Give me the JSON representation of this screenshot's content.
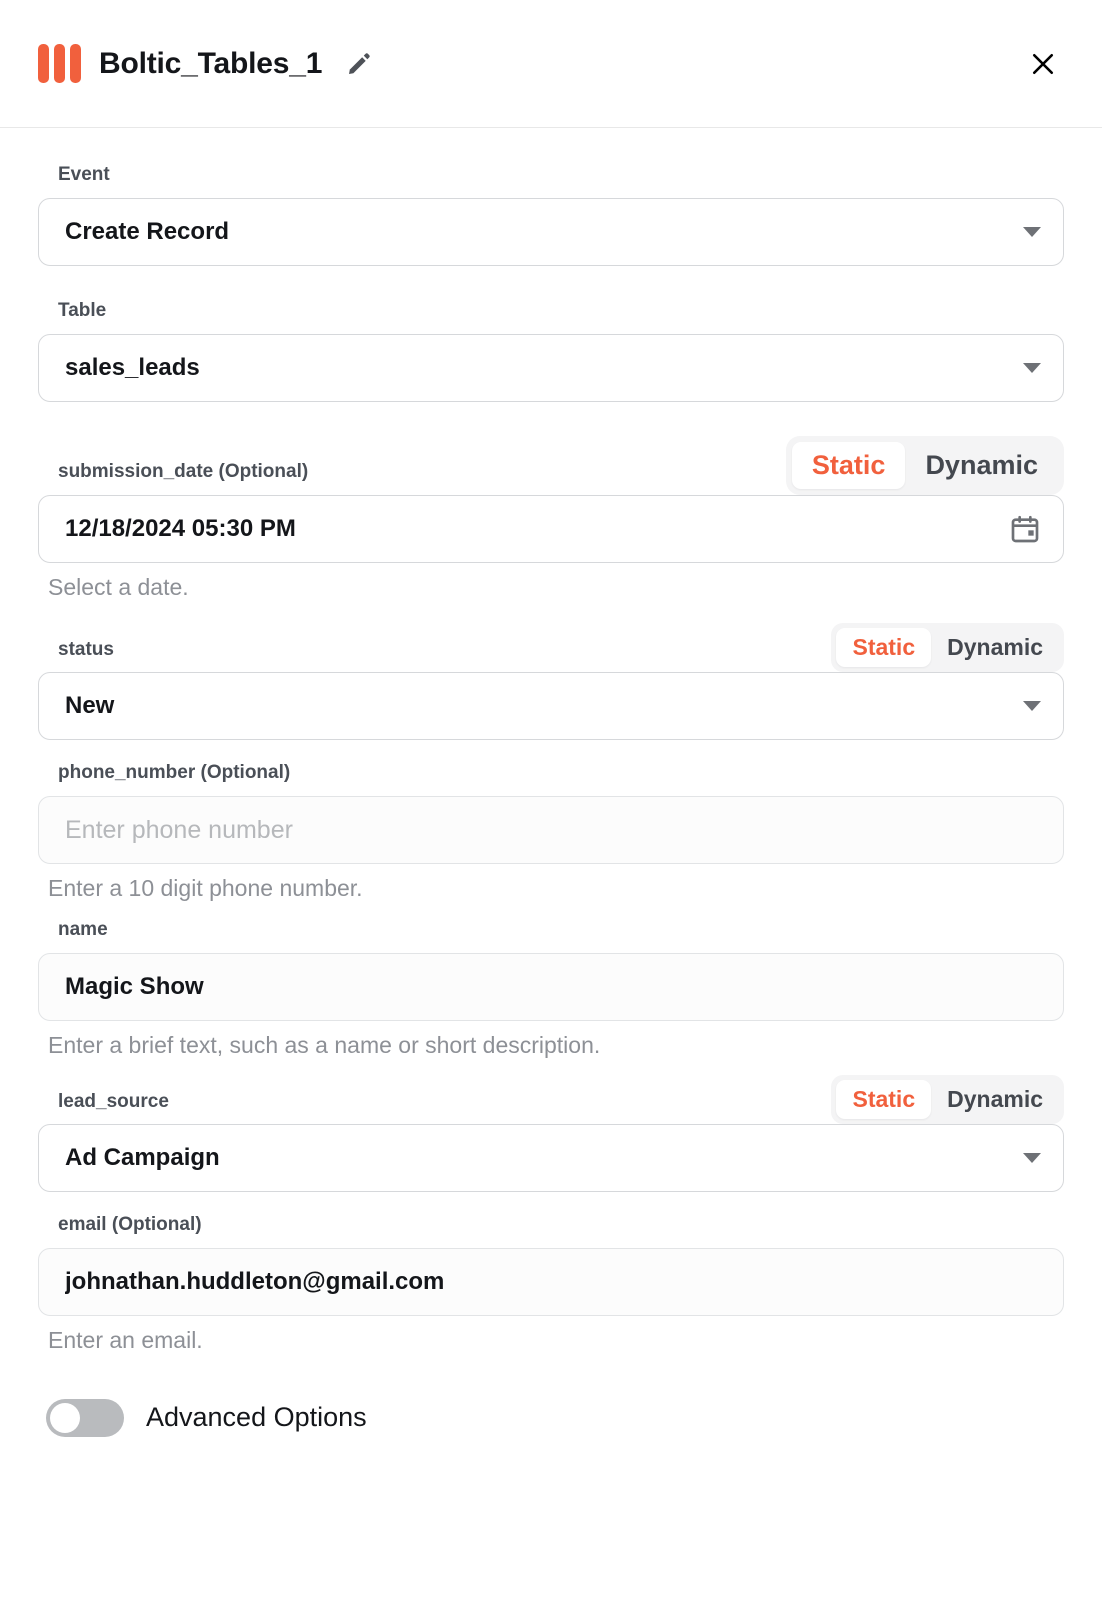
{
  "header": {
    "title": "Boltic_Tables_1",
    "edit_icon": "pencil-icon",
    "close_icon": "close-icon",
    "logo_color": "#f1603d"
  },
  "toggle": {
    "static_label": "Static",
    "dynamic_label": "Dynamic",
    "active": "Static",
    "active_color": "#f1603d"
  },
  "fields": {
    "event": {
      "label": "Event",
      "value": "Create Record"
    },
    "table": {
      "label": "Table",
      "value": "sales_leads"
    },
    "submission_date": {
      "label": "submission_date (Optional)",
      "value": "12/18/2024 05:30 PM",
      "helper": "Select a date.",
      "icon": "calendar-icon"
    },
    "status": {
      "label": "status",
      "value": "New"
    },
    "phone_number": {
      "label": "phone_number (Optional)",
      "value": "",
      "placeholder": "Enter phone number",
      "helper": "Enter a 10 digit phone number."
    },
    "name": {
      "label": "name",
      "value": "Magic Show",
      "helper": "Enter a brief text, such as a name or short description."
    },
    "lead_source": {
      "label": "lead_source",
      "value": "Ad Campaign"
    },
    "email": {
      "label": "email (Optional)",
      "value": "johnathan.huddleton@gmail.com",
      "helper": "Enter an email."
    }
  },
  "advanced_options": {
    "label": "Advanced Options",
    "enabled": false
  }
}
